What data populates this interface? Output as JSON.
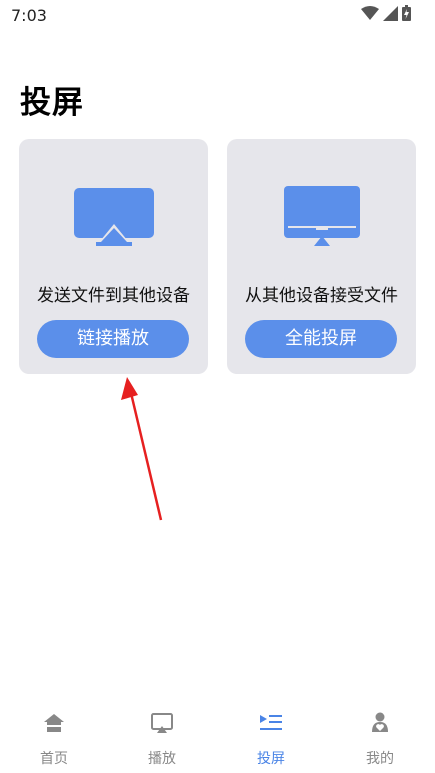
{
  "status_bar": {
    "time": "7:03"
  },
  "page": {
    "title": "投屏"
  },
  "cards": [
    {
      "text": "发送文件到其他设备",
      "button": "链接播放"
    },
    {
      "text": "从其他设备接受文件",
      "button": "全能投屏"
    }
  ],
  "bottom_nav": {
    "items": [
      {
        "label": "首页",
        "icon": "home-icon"
      },
      {
        "label": "播放",
        "icon": "airplay-icon"
      },
      {
        "label": "投屏",
        "icon": "cast-list-icon",
        "active": true
      },
      {
        "label": "我的",
        "icon": "profile-icon"
      }
    ]
  },
  "colors": {
    "accent": "#5b8fea",
    "card_bg": "#e6e6eb",
    "nav_active": "#4a84e6",
    "nav_inactive": "#888888",
    "annotation_arrow": "#e62020"
  }
}
